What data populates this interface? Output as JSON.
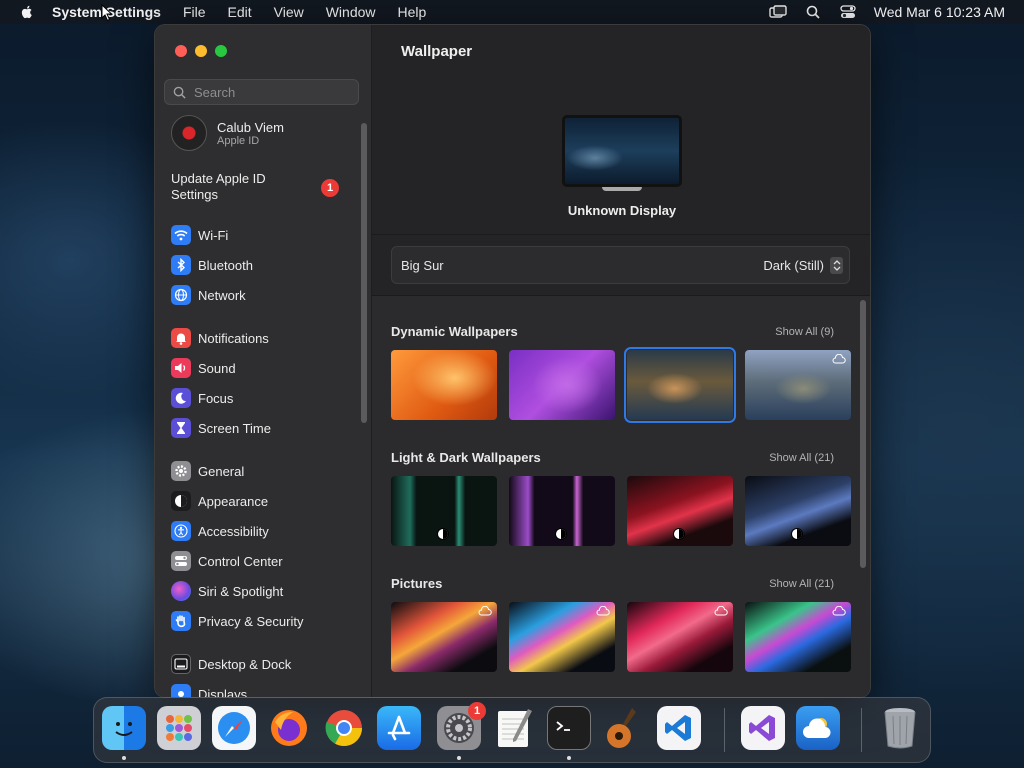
{
  "menubar": {
    "app_name": "System Settings",
    "menus": [
      "File",
      "Edit",
      "View",
      "Window",
      "Help"
    ],
    "clock": "Wed Mar 6  10:23 AM"
  },
  "sidebar": {
    "search_placeholder": "Search",
    "account": {
      "name": "Calub Viem",
      "sub": "Apple ID"
    },
    "update": {
      "label": "Update Apple ID Settings",
      "badge": "1"
    },
    "items": [
      {
        "label": "Wi-Fi",
        "icon": "wifi-icon",
        "color": "#2f7df6"
      },
      {
        "label": "Bluetooth",
        "icon": "bluetooth-icon",
        "color": "#2f7df6"
      },
      {
        "label": "Network",
        "icon": "globe-icon",
        "color": "#2f7df6"
      },
      {
        "label": "Notifications",
        "icon": "bell-icon",
        "color": "#ec4b45"
      },
      {
        "label": "Sound",
        "icon": "speaker-icon",
        "color": "#ec3b5a"
      },
      {
        "label": "Focus",
        "icon": "moon-icon",
        "color": "#5b4fd8"
      },
      {
        "label": "Screen Time",
        "icon": "hourglass-icon",
        "color": "#5b4fd8"
      },
      {
        "label": "General",
        "icon": "gear-icon",
        "color": "#8e8e93"
      },
      {
        "label": "Appearance",
        "icon": "appearance-icon",
        "color": "#1c1c1e"
      },
      {
        "label": "Accessibility",
        "icon": "accessibility-icon",
        "color": "#2f7df6"
      },
      {
        "label": "Control Center",
        "icon": "control-center-icon",
        "color": "#8e8e93"
      },
      {
        "label": "Siri & Spotlight",
        "icon": "siri-icon",
        "color": "#a24bd8"
      },
      {
        "label": "Privacy & Security",
        "icon": "hand-icon",
        "color": "#2f7df6"
      },
      {
        "label": "Desktop & Dock",
        "icon": "dock-icon",
        "color": "#1c1c1e"
      },
      {
        "label": "Displays",
        "icon": "display-icon",
        "color": "#2f7df6"
      }
    ]
  },
  "main": {
    "title": "Wallpaper",
    "display_name": "Unknown Display",
    "picker": {
      "name": "Big Sur",
      "mode": "Dark (Still)"
    },
    "sections": [
      {
        "title": "Dynamic Wallpapers",
        "show_all": "Show All (9)"
      },
      {
        "title": "Light & Dark Wallpapers",
        "show_all": "Show All (21)"
      },
      {
        "title": "Pictures",
        "show_all": "Show All (21)"
      }
    ]
  },
  "dock": {
    "apps": [
      "finder-icon",
      "launchpad-icon",
      "safari-icon",
      "firefox-icon",
      "chrome-icon",
      "app-store-icon",
      "system-settings-icon",
      "textedit-icon",
      "terminal-icon",
      "garageband-icon",
      "vscode-icon",
      "visual-studio-icon",
      "weather-icon",
      "trash-icon"
    ],
    "settings_badge": "1"
  },
  "colors": {
    "accent": "#2f79e6",
    "badge": "#ec3b36"
  }
}
